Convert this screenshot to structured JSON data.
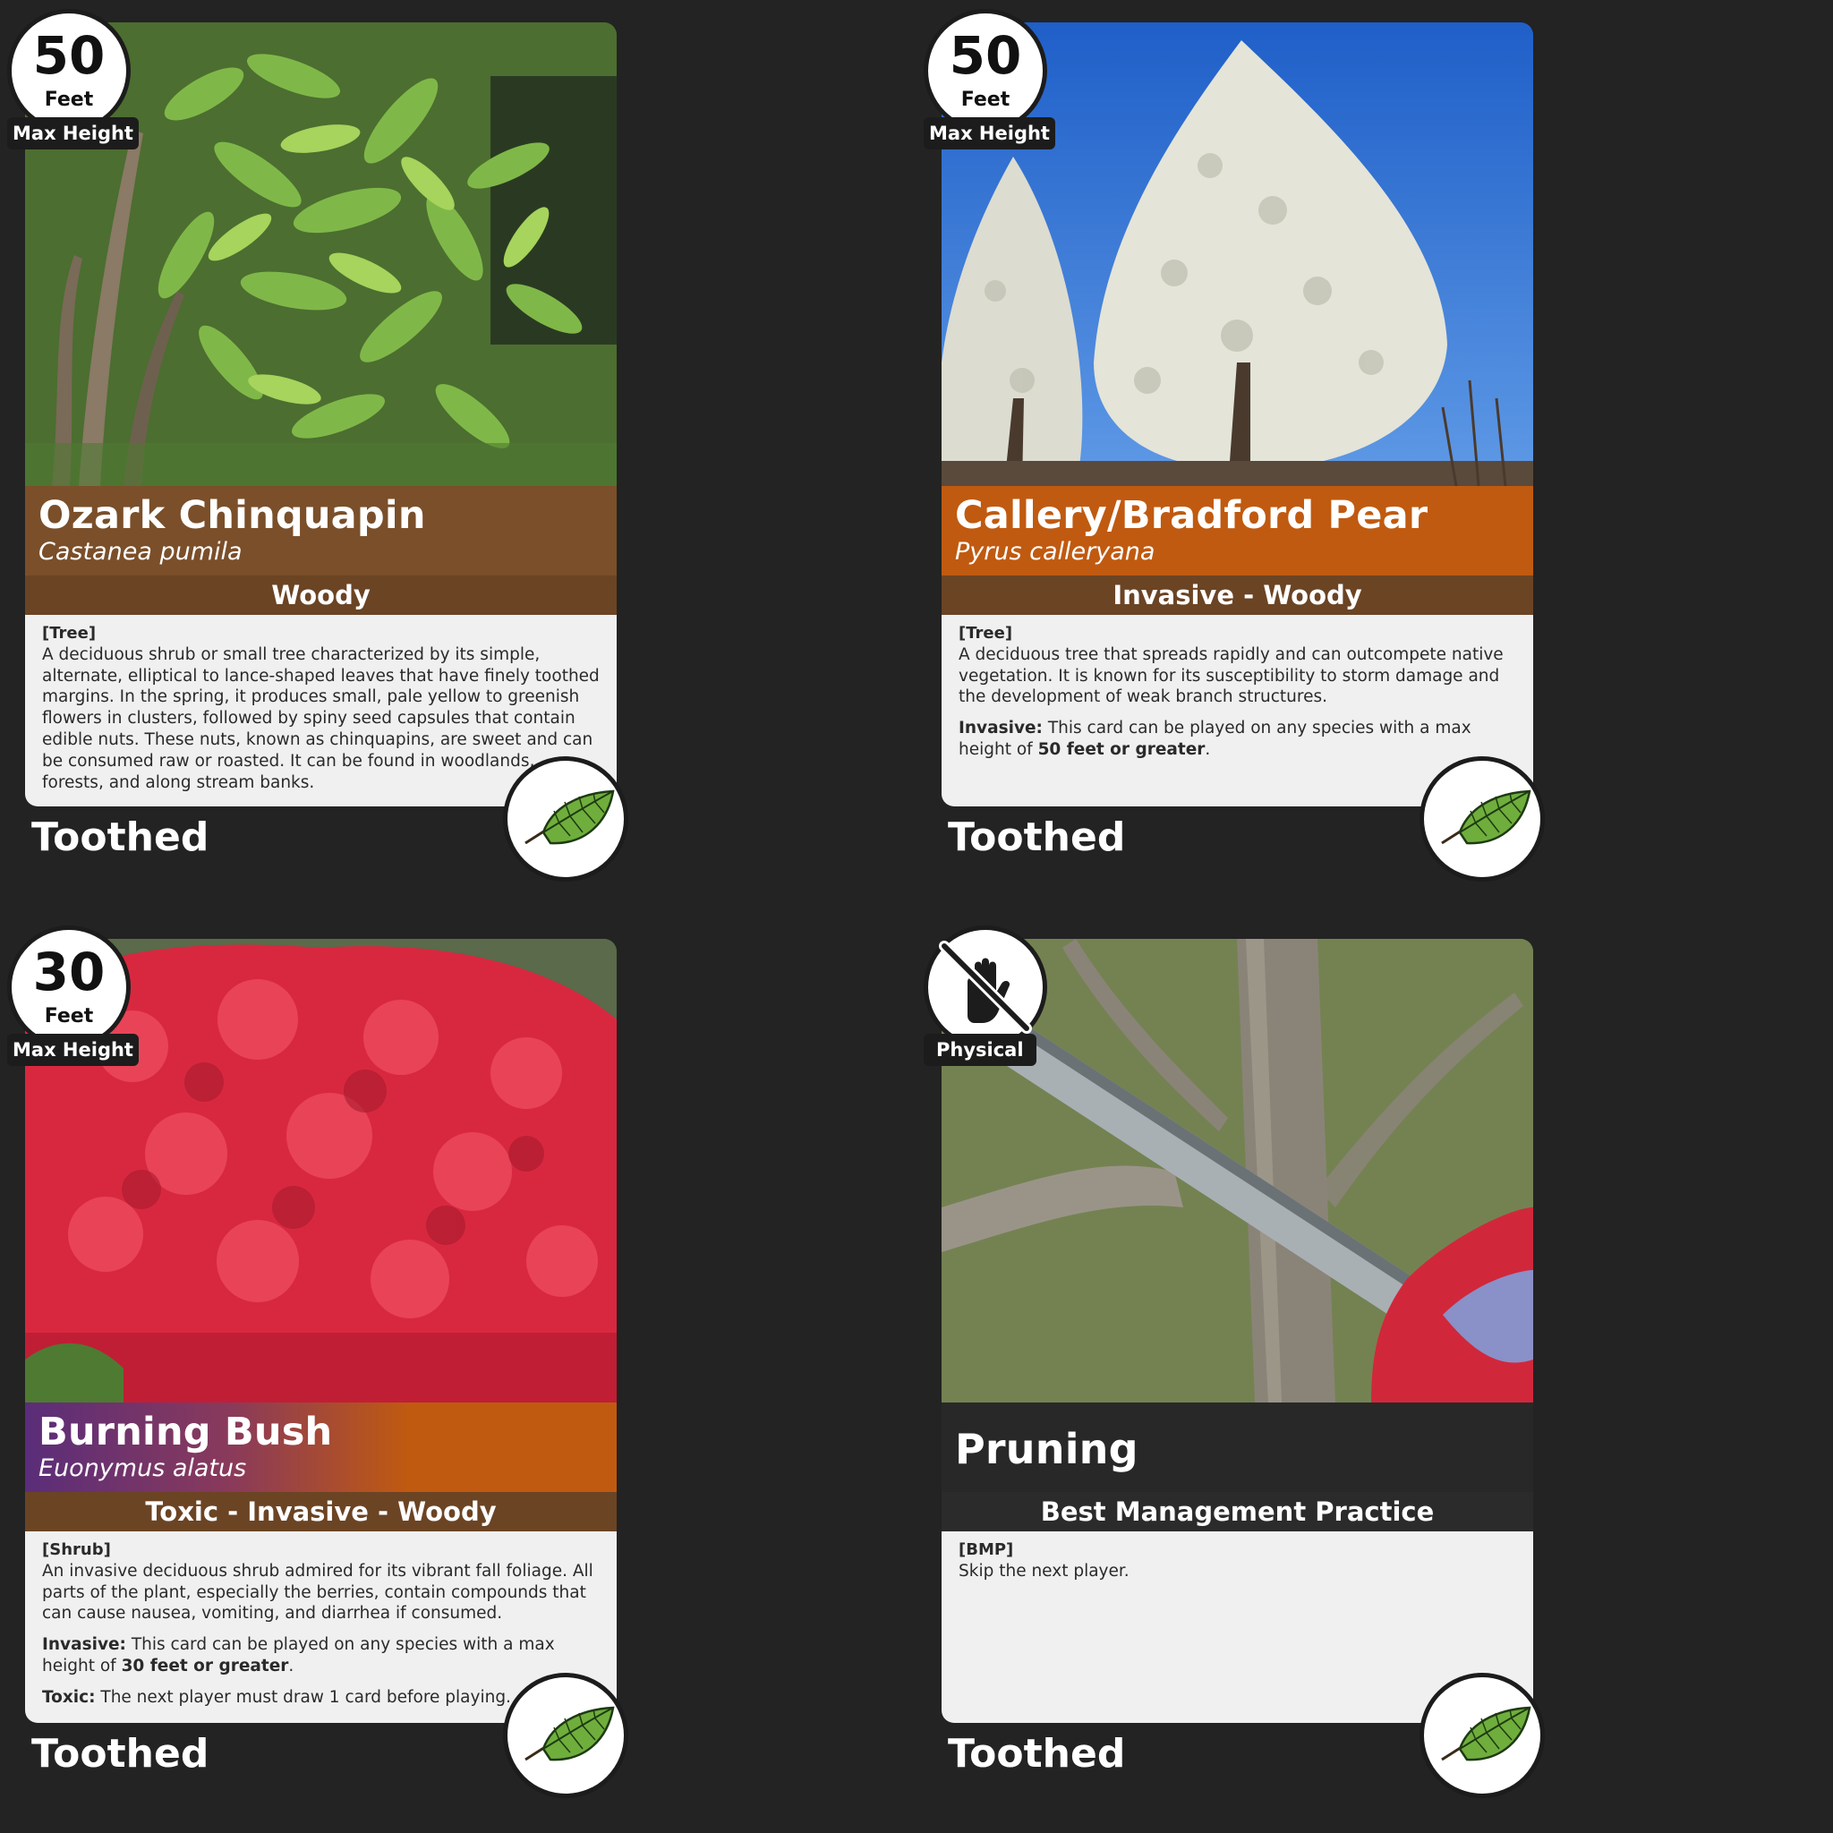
{
  "cards": [
    {
      "height_value": "50",
      "height_unit": "Feet",
      "height_label": "Max Height",
      "name": "Ozark Chinquapin",
      "scientific": "Castanea pumila",
      "type": "Woody",
      "tag": "[Tree]",
      "description": "A deciduous shrub or small tree characterized by its simple, alternate, elliptical to lance-shaped leaves that have finely toothed margins. In the spring, it produces small, pale yellow to greenish flowers in clusters, followed by spiny seed capsules that contain edible nuts. These nuts, known as chinquapins, are sweet and can be consumed raw or roasted. It can be found in woodlands, forests, and along stream banks.",
      "leaf_type": "Toothed",
      "leaf_icon": "toothed-leaf-icon",
      "title_color": "#7a4f2a"
    },
    {
      "height_value": "50",
      "height_unit": "Feet",
      "height_label": "Max Height",
      "name": "Callery/Bradford Pear",
      "scientific": "Pyrus calleryana",
      "type": "Invasive - Woody",
      "tag": "[Tree]",
      "description": "A deciduous tree that spreads rapidly and can outcompete native vegetation. It is known for its susceptibility to storm damage and the development of weak branch structures.",
      "rule_label": "Invasive:",
      "rule_text": " This card can be played on any species with a max height of ",
      "rule_bold": "50 feet or greater",
      "rule_end": ".",
      "leaf_type": "Toothed",
      "leaf_icon": "toothed-leaf-icon",
      "title_color": "#c05a10"
    },
    {
      "height_value": "30",
      "height_unit": "Feet",
      "height_label": "Max Height",
      "name": "Burning Bush",
      "scientific": "Euonymus alatus",
      "type": "Toxic - Invasive - Woody",
      "tag": "[Shrub]",
      "description": "An invasive deciduous shrub admired for its vibrant fall foliage. All parts of the plant, especially the berries, contain compounds that can cause nausea, vomiting, and diarrhea if consumed.",
      "rule_label": "Invasive:",
      "rule_text": " This card can be played on any species with a max height of ",
      "rule_bold": "30 feet or greater",
      "rule_end": ".",
      "toxic_label": "Toxic:",
      "toxic_text": " The next player must draw 1 card before playing.",
      "leaf_type": "Toothed",
      "leaf_icon": "toothed-leaf-icon",
      "title_color": "#5a2d7a"
    },
    {
      "badge_icon": "no-hand-icon",
      "badge_label": "Physical",
      "name": "Pruning",
      "type": "Best Management Practice",
      "tag": "[BMP]",
      "description": "Skip the next player.",
      "leaf_type": "Toothed",
      "leaf_icon": "toothed-leaf-icon",
      "title_color": "#2b2b2b"
    }
  ]
}
